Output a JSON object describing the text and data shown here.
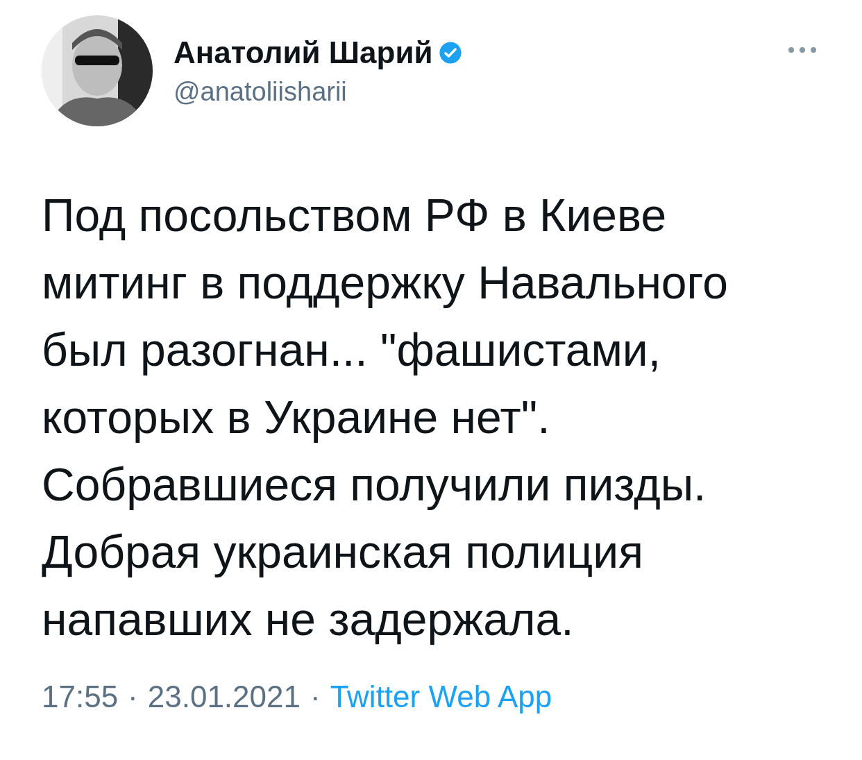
{
  "author": {
    "name": "Анатолий Шарий",
    "verified": true,
    "handle": "@anatoliisharii"
  },
  "tweet": {
    "lines": [
      "Под посольством РФ в Киеве",
      "митинг в поддержку Навального",
      "был разогнан... \"фашистами,",
      "которых в Украине нет\".",
      "Собравшиеся получили пизды.",
      "Добрая украинская полиция",
      "напавших не задержала."
    ]
  },
  "footer": {
    "time": "17:55",
    "separator_1": "·",
    "date": "23.01.2021",
    "separator_2": "·",
    "source": "Twitter Web App"
  }
}
